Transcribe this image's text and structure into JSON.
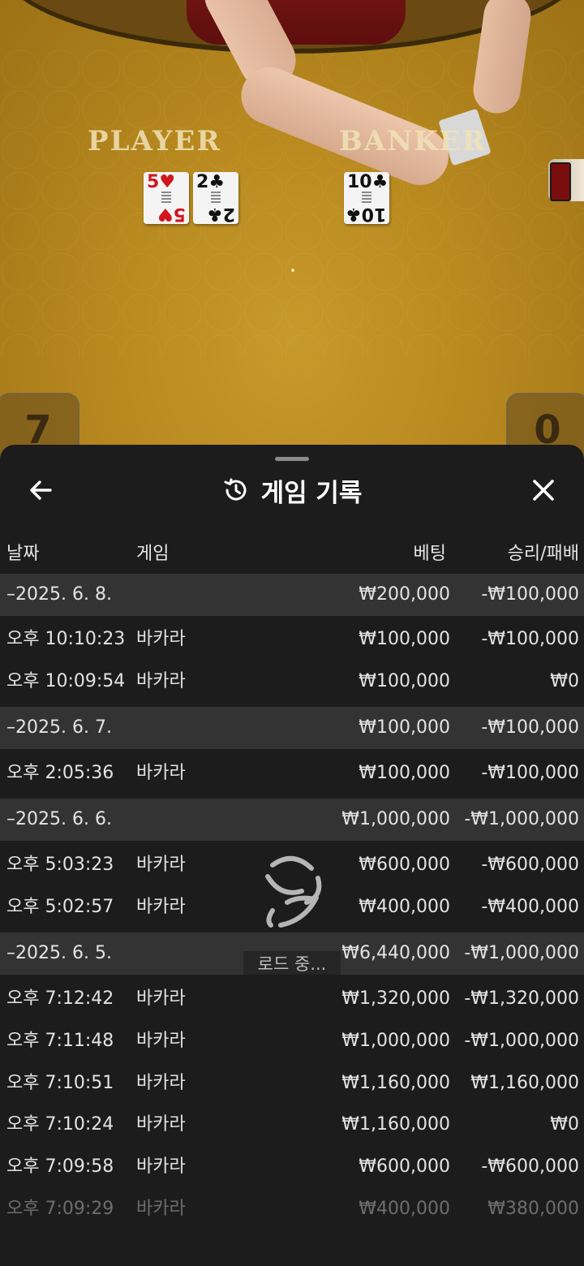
{
  "table": {
    "player_label": "PLAYER",
    "banker_label": "BANKER",
    "player_cards": [
      {
        "rank": "5",
        "suit": "♥",
        "color": "red"
      },
      {
        "rank": "2",
        "suit": "♣",
        "color": "black"
      }
    ],
    "banker_cards": [
      {
        "rank": "10",
        "suit": "♣",
        "color": "black"
      }
    ],
    "player_score": "7",
    "banker_score": "0"
  },
  "sheet": {
    "title": "게임 기록",
    "back_icon": "arrow-left-icon",
    "history_icon": "history-icon",
    "close_icon": "close-icon",
    "columns": {
      "date": "날짜",
      "game": "게임",
      "bet": "베팅",
      "result": "승리/패배"
    },
    "loading_text": "로드 중...",
    "rows": [
      {
        "type": "date",
        "time": "–2025. 6. 8.",
        "game": "",
        "bet": "₩200,000",
        "result": "-₩100,000"
      },
      {
        "type": "entry",
        "time": "오후 10:10:23",
        "game": "바카라",
        "bet": "₩100,000",
        "result": "-₩100,000"
      },
      {
        "type": "entry",
        "time": "오후 10:09:54",
        "game": "바카라",
        "bet": "₩100,000",
        "result": "₩0"
      },
      {
        "type": "date",
        "time": "–2025. 6. 7.",
        "game": "",
        "bet": "₩100,000",
        "result": "-₩100,000"
      },
      {
        "type": "entry",
        "time": "오후 2:05:36",
        "game": "바카라",
        "bet": "₩100,000",
        "result": "-₩100,000"
      },
      {
        "type": "date",
        "time": "–2025. 6. 6.",
        "game": "",
        "bet": "₩1,000,000",
        "result": "-₩1,000,000"
      },
      {
        "type": "entry",
        "time": "오후 5:03:23",
        "game": "바카라",
        "bet": "₩600,000",
        "result": "-₩600,000"
      },
      {
        "type": "entry",
        "time": "오후 5:02:57",
        "game": "바카라",
        "bet": "₩400,000",
        "result": "-₩400,000"
      },
      {
        "type": "date",
        "time": "–2025. 6. 5.",
        "game": "",
        "bet": "₩6,440,000",
        "result": "-₩1,000,000"
      },
      {
        "type": "entry",
        "time": "오후 7:12:42",
        "game": "바카라",
        "bet": "₩1,320,000",
        "result": "-₩1,320,000"
      },
      {
        "type": "entry",
        "time": "오후 7:11:48",
        "game": "바카라",
        "bet": "₩1,000,000",
        "result": "-₩1,000,000"
      },
      {
        "type": "entry",
        "time": "오후 7:10:51",
        "game": "바카라",
        "bet": "₩1,160,000",
        "result": "₩1,160,000"
      },
      {
        "type": "entry",
        "time": "오후 7:10:24",
        "game": "바카라",
        "bet": "₩1,160,000",
        "result": "₩0"
      },
      {
        "type": "entry",
        "time": "오후 7:09:58",
        "game": "바카라",
        "bet": "₩600,000",
        "result": "-₩600,000"
      },
      {
        "type": "entry",
        "time": "오후 7:09:29",
        "game": "바카라",
        "bet": "₩400,000",
        "result": "₩380,000"
      }
    ]
  }
}
